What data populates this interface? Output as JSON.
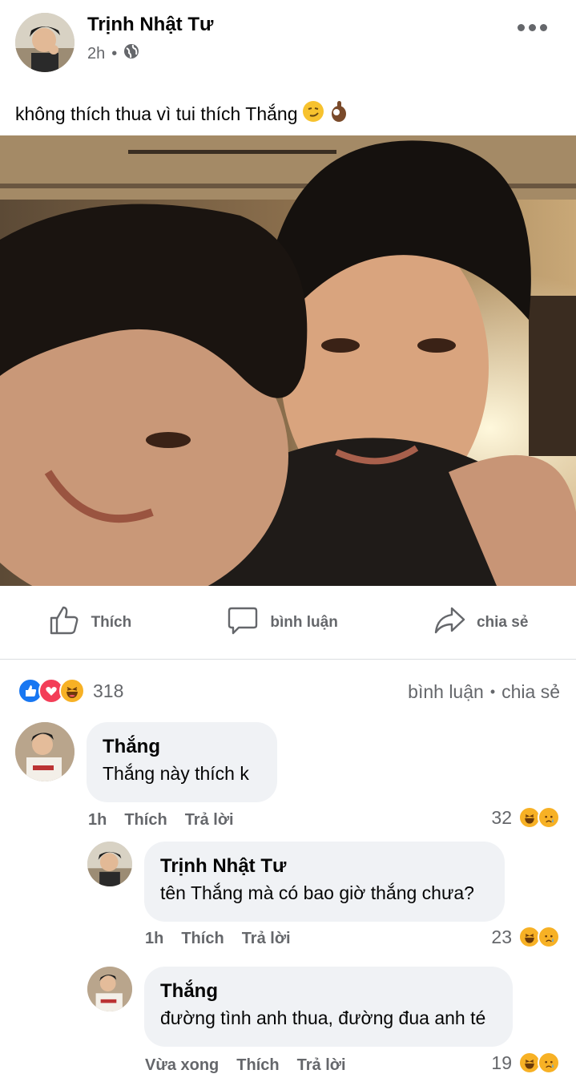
{
  "post": {
    "author": "Trịnh Nhật Tư",
    "time": "2h",
    "dot": "•",
    "caption": "không thích thua vì tui thích Thắng"
  },
  "actions": {
    "like": "Thích",
    "comment": "bình luận",
    "share": "chia sẻ"
  },
  "reactions": {
    "count": "318",
    "comments": "bình luận",
    "dot": "•",
    "shares": "chia sẻ"
  },
  "comments": [
    {
      "name": "Thắng",
      "text": "Thắng này thích k",
      "time": "1h",
      "like": "Thích",
      "reply": "Trả lời",
      "reaction_count": "32"
    },
    {
      "name": "Trịnh Nhật Tư",
      "text": "tên Thắng mà có bao giờ thắng chưa?",
      "time": "1h",
      "like": "Thích",
      "reply": "Trả lời",
      "reaction_count": "23"
    },
    {
      "name": "Thắng",
      "text": "đường tình anh thua, đường đua anh té",
      "time": "Vừa xong",
      "like": "Thích",
      "reply": "Trả lời",
      "reaction_count": "19"
    }
  ],
  "colors": {
    "like_blue": "#1877f2",
    "love_red": "#f33e58",
    "haha_yellow": "#f7b125",
    "secondary_text": "#65676b",
    "bubble_bg": "#f0f2f5"
  }
}
